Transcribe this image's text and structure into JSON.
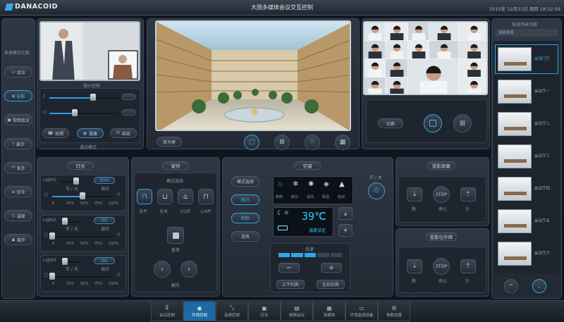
{
  "header": {
    "logo": "DANACOID",
    "title": "大国多媒体会议交互控制",
    "datetime": "2015年 12月31日 周四 18:32:56"
  },
  "left_sidebar": {
    "title": "快速模式切换",
    "items": [
      "会议",
      "投影",
      "视频会议",
      "演示",
      "发言",
      "信号",
      "温度",
      "离开"
    ]
  },
  "camera_panel": {
    "title": "镜头控制",
    "buttons": [
      "拍照",
      "摄像",
      "结束"
    ],
    "mode_label": "通话模式"
  },
  "main_video": {
    "label": "放大屏"
  },
  "video_wall": {
    "label": "切换"
  },
  "right_sidebar": {
    "title": "快速场景切换",
    "search_placeholder": "搜索场景",
    "items": [
      "会场门厅",
      "会议厅一",
      "会议厅二",
      "会议厅三",
      "会议厅四",
      "会议厅五",
      "会议厅六"
    ]
  },
  "lights": {
    "title": "灯光",
    "rows": [
      {
        "name": "Light1",
        "sub": "节 / 光",
        "value": "50%",
        "mode": "调光",
        "scale": [
          "0",
          "25%",
          "50%",
          "75%",
          "100%"
        ]
      },
      {
        "name": "Light2",
        "sub": "节 / 光",
        "value": "0%",
        "mode": "调光",
        "scale": [
          "0",
          "25%",
          "50%",
          "75%",
          "100%"
        ]
      },
      {
        "name": "Light3",
        "sub": "节 / 光",
        "value": "0%",
        "mode": "调光",
        "scale": [
          "0",
          "25%",
          "50%",
          "75%",
          "100%"
        ]
      }
    ]
  },
  "curtain": {
    "title": "窗帘",
    "mode_title": "模式选择",
    "modes": [
      "全开",
      "全关",
      "1/2开",
      "1/4开"
    ],
    "stop_label": "暂停",
    "nav_label": "翻页"
  },
  "aircon": {
    "title": "空调",
    "modes": [
      "模式选择",
      "制冷",
      "制热",
      "送风"
    ],
    "icons": [
      "制热",
      "制冷",
      "送风",
      "除湿",
      "自动"
    ],
    "temperature": "39℃",
    "power_label": "开 / 关",
    "setting_label": "温度设定",
    "fan_label": "风速",
    "buttons": [
      "上下扫风",
      "左右扫风"
    ]
  },
  "projector_screen": {
    "title": "投影屏幕",
    "labels": [
      "降",
      "停止",
      "升"
    ],
    "stop": "STOP"
  },
  "projector_lift": {
    "title": "投影仪升降",
    "labels": [
      "降",
      "停止",
      "升"
    ],
    "stop": "STOP"
  },
  "bottom_tabs": [
    "会议控制",
    "环境控制",
    "音频控制",
    "灯光",
    "视频会议",
    "多媒体",
    "环境监测设备",
    "参数设置"
  ]
}
